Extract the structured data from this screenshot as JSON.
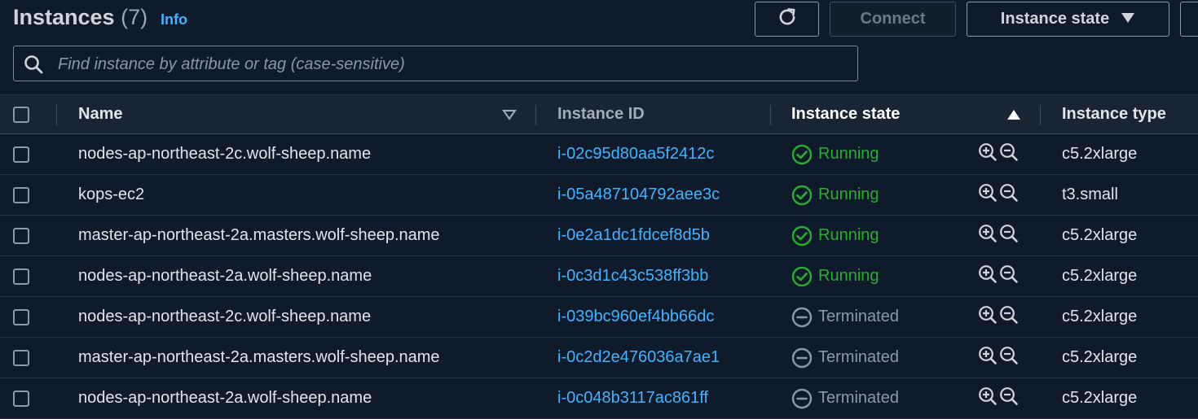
{
  "header": {
    "title": "Instances",
    "count": "(7)",
    "info_label": "Info"
  },
  "toolbar": {
    "refresh_icon": "refresh-icon",
    "connect_label": "Connect",
    "instance_state_label": "Instance state"
  },
  "search": {
    "placeholder": "Find instance by attribute or tag (case-sensitive)",
    "value": ""
  },
  "table": {
    "columns": {
      "name": "Name",
      "instance_id": "Instance ID",
      "instance_state": "Instance state",
      "instance_type": "Instance type"
    },
    "sort": {
      "column": "instance_state",
      "direction": "ascending"
    },
    "rows": [
      {
        "name": "nodes-ap-northeast-2c.wolf-sheep.name",
        "id": "i-02c95d80aa5f2412c",
        "state": "Running",
        "type": "c5.2xlarge"
      },
      {
        "name": "kops-ec2",
        "id": "i-05a487104792aee3c",
        "state": "Running",
        "type": "t3.small"
      },
      {
        "name": "master-ap-northeast-2a.masters.wolf-sheep.name",
        "id": "i-0e2a1dc1fdcef8d5b",
        "state": "Running",
        "type": "c5.2xlarge"
      },
      {
        "name": "nodes-ap-northeast-2a.wolf-sheep.name",
        "id": "i-0c3d1c43c538ff3bb",
        "state": "Running",
        "type": "c5.2xlarge"
      },
      {
        "name": "nodes-ap-northeast-2c.wolf-sheep.name",
        "id": "i-039bc960ef4bb66dc",
        "state": "Terminated",
        "type": "c5.2xlarge"
      },
      {
        "name": "master-ap-northeast-2a.masters.wolf-sheep.name",
        "id": "i-0c2d2e476036a7ae1",
        "state": "Terminated",
        "type": "c5.2xlarge"
      },
      {
        "name": "nodes-ap-northeast-2a.wolf-sheep.name",
        "id": "i-0c048b3117ac861ff",
        "state": "Terminated",
        "type": "c5.2xlarge"
      }
    ]
  },
  "colors": {
    "background": "#0f1b2a",
    "link": "#42b4ff",
    "running": "#29ad32",
    "terminated": "#8d99a8"
  }
}
